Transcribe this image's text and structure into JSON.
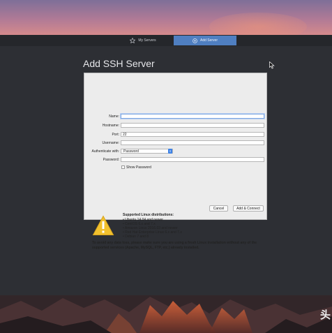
{
  "tabs": [
    {
      "label": "My Servers",
      "icon": "star-icon"
    },
    {
      "label": "Add Server",
      "icon": "plus-circle-icon",
      "active": true
    }
  ],
  "panel": {
    "title": "Add SSH Server"
  },
  "form": {
    "name_label": "Name:",
    "name_value": "",
    "hostname_label": "Hostname:",
    "hostname_value": "",
    "port_label": "Port:",
    "port_value": "22",
    "username_label": "Username:",
    "username_value": "",
    "auth_label": "Authenticate with:",
    "auth_value": "Password",
    "password_label": "Password:",
    "password_value": "",
    "show_password_label": "Show Password",
    "show_password_checked": false
  },
  "buttons": {
    "cancel": "Cancel",
    "add_connect": "Add & Connect"
  },
  "warning": {
    "icon": "warning-triangle-icon",
    "title": "Supported Linux distributions:",
    "distros": [
      "• Ubuntu 14.04 and newer",
      "• CentOS 6.x and 7.x",
      "• Amazon Linux 2016.03 and newer",
      "• Red Hat Enterprise Linux 6.x and 7.x",
      "• Debian 7 and 8"
    ],
    "text": "To avoid any data loss, please make sure you are using a fresh Linux installation without any of the supported services (Apache, MySQL, FTP, etc.) already installed."
  },
  "watermark": "头",
  "colors": {
    "accent": "#4f7fc1",
    "select_blue": "#3d82e6",
    "warning_yellow": "#f2c12e",
    "app_bg": "#2d2f34"
  }
}
